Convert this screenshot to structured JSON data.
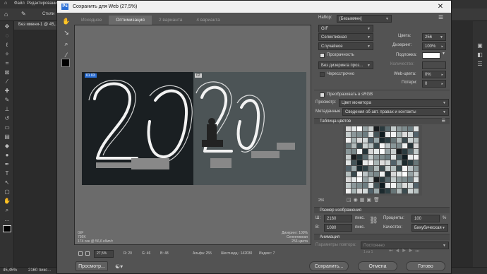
{
  "ps": {
    "menu": [
      "Файл",
      "Редактирование"
    ],
    "options": [
      "Стили"
    ],
    "doc_tab": "Без имени-1 @ 45,...",
    "status_zoom": "45,45%",
    "status_size": "2160 пикс..."
  },
  "dialog": {
    "title": "Сохранить для Web (27,5%)",
    "tabs": [
      "Исходное",
      "Оптимизация",
      "2 варианта",
      "4 варианта"
    ],
    "active_tab": "Оптимизация",
    "image_label_left": "01 03",
    "image_label_right": "02",
    "info_left": [
      "GIF",
      "736K",
      "174 сек @ 56,6 кбит/с"
    ],
    "info_right": [
      "Дизеринг: 100%",
      "Селективная",
      "256 цвета"
    ],
    "status": {
      "zoom": "27,5%",
      "r": "R: 20",
      "g": "G: 46",
      "b": "B: 48",
      "alpha": "Альфа: 255",
      "hex": "Шестнадц.: 142030",
      "index": "Индекс: 7"
    },
    "buttons": {
      "preview": "Просмотр...",
      "save": "Сохранить...",
      "cancel": "Отмена",
      "done": "Готово"
    },
    "settings": {
      "preset_label": "Набор:",
      "preset_value": "[Безымянн]",
      "format": "GIF",
      "reduction": "Селективная",
      "colors_label": "Цвета:",
      "colors_value": "256",
      "dither_algo": "Случайное",
      "dither_label": "Дизеринг:",
      "dither_value": "100%",
      "transparency": "Прозрачность",
      "matte_label": "Подложка:",
      "trans_dither": "Без дизеринга проз...",
      "amount_label": "Количество:",
      "interlaced": "Чересстрочно",
      "websnap_label": "Web-цвета:",
      "websnap_value": "0%",
      "lossy_label": "Потери:",
      "lossy_value": "0",
      "convert_srgb": "Преобразовать в sRGB",
      "preview_label": "Просмотр:",
      "preview_value": "Цвет монитора",
      "metadata_label": "Метаданные:",
      "metadata_value": "Сведения об авт. правах и контакты"
    },
    "color_table": {
      "title": "Таблица цветов",
      "count": "256",
      "colors": [
        "#d8d8d8",
        "#bcc4c6",
        "#3c4c50",
        "#9aa8aa",
        "#f2f2f2",
        "#6c7c80",
        "#2a3a3e",
        "#e4e8e8",
        "#889698",
        "#cbd2d2",
        "#1c2a2e",
        "#a8b4b4",
        "#e0e4e4",
        "#5a6a6e",
        "#ffffff",
        "#7a888a",
        "#b4bebe",
        "#2e4044",
        "#dcdcdc",
        "#445458",
        "#c4cccc",
        "#96a2a4",
        "#eef0f0",
        "#3a4a4e",
        "#687678",
        "#d2d8d8",
        "#101c20",
        "#8c989a",
        "#c8cece",
        "#263438",
        "#f6f6f6",
        "#b0baba",
        "#52626a",
        "#e8eaea",
        "#7e8c8e",
        "#181c1e"
      ]
    },
    "image_size": {
      "title": "Размер изображения",
      "w_label": "Ш:",
      "w_value": "2160",
      "h_label": "В:",
      "h_value": "1080",
      "unit": "пикс.",
      "percent_label": "Проценты:",
      "percent_value": "100",
      "percent_unit": "%",
      "quality_label": "Качество:",
      "quality_value": "Бикубическая"
    },
    "animation": {
      "title": "Анимация",
      "loop_label": "Параметры повтора:",
      "loop_value": "Постоянно",
      "frame": "1 из 1"
    }
  }
}
